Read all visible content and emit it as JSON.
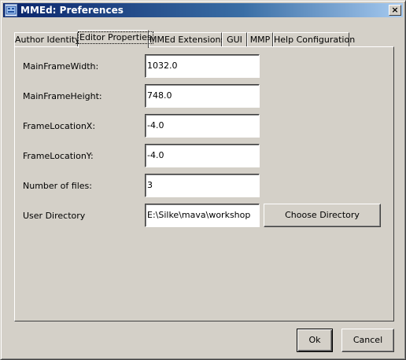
{
  "window": {
    "title": "MMEd: Preferences",
    "close_label": "×"
  },
  "tabs": [
    {
      "label": "Author Identity",
      "active": false
    },
    {
      "label": "Editor Properties",
      "active": true
    },
    {
      "label": "MMEd Extensions",
      "active": false
    },
    {
      "label": "GUI",
      "active": false
    },
    {
      "label": "MMP",
      "active": false
    },
    {
      "label": "Help Configuration",
      "active": false
    }
  ],
  "fields": [
    {
      "label": "MainFrameWidth:",
      "value": "1032.0"
    },
    {
      "label": "MainFrameHeight:",
      "value": "748.0"
    },
    {
      "label": "FrameLocationX:",
      "value": "-4.0"
    },
    {
      "label": "FrameLocationY:",
      "value": "-4.0"
    },
    {
      "label": "Number of files:",
      "value": "3"
    },
    {
      "label": "User Directory",
      "value": "E:\\Silke\\mava\\workshop"
    }
  ],
  "choose_directory_label": "Choose Directory",
  "footer": {
    "ok_label": "Ok",
    "cancel_label": "Cancel"
  }
}
